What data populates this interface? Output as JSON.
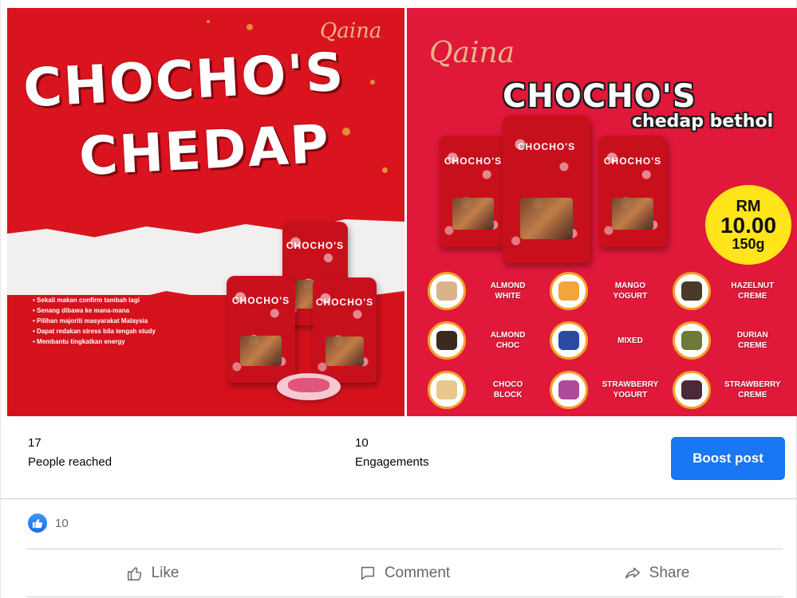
{
  "images": {
    "left": {
      "brand": "Qaina",
      "title_line1": "CHOCHO'S",
      "title_line2": "CHEDAP",
      "bullets": [
        "Sekali makan confirm tambah lagi",
        "Senang dibawa ke mana-mana",
        "Pilihan majoriti masyarakat Malaysia",
        "Dapat redakan stress bila tengah study",
        "Membantu tingkatkan energy"
      ],
      "pouch_label": "CHOCHO'S"
    },
    "right": {
      "brand": "Qaina",
      "title": "CHOCHO'S",
      "subtitle": "chedap bethol",
      "pouch_label": "CHOCHO'S",
      "price": {
        "currency": "RM",
        "amount": "10.00",
        "weight": "150g"
      },
      "flavours": [
        {
          "line1": "ALMOND",
          "line2": "WHITE"
        },
        {
          "line1": "MANGO",
          "line2": "YOGURT"
        },
        {
          "line1": "HAZELNUT",
          "line2": "CREME"
        },
        {
          "line1": "ALMOND",
          "line2": "CHOC"
        },
        {
          "line1": "MIXED",
          "line2": ""
        },
        {
          "line1": "DURIAN",
          "line2": "CREME"
        },
        {
          "line1": "CHOCO",
          "line2": "BLOCK"
        },
        {
          "line1": "STRAWBERRY",
          "line2": "YOGURT"
        },
        {
          "line1": "STRAWBERRY",
          "line2": "CREME"
        }
      ]
    }
  },
  "stats": {
    "reached_count": "17",
    "reached_label": "People reached",
    "engagement_count": "10",
    "engagement_label": "Engagements",
    "boost_label": "Boost post"
  },
  "reactions": {
    "icon": "thumbs-up-icon",
    "count": "10"
  },
  "actions": {
    "like": "Like",
    "comment": "Comment",
    "share": "Share"
  },
  "colors": {
    "accent": "#1877f2",
    "muted_text": "#65676b",
    "divider": "#ced0d4"
  }
}
